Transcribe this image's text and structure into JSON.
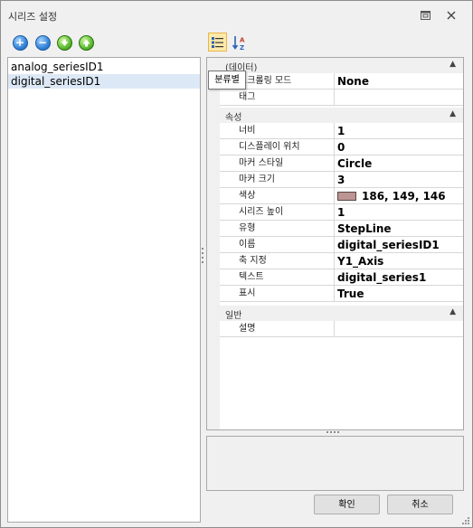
{
  "window": {
    "title": "시리즈 설정"
  },
  "left_toolbar": {
    "icons": [
      "add-icon",
      "remove-icon",
      "move-down-icon",
      "move-up-icon"
    ]
  },
  "right_toolbar": {
    "icons": [
      "categorized-icon",
      "sort-alphabetical-icon"
    ]
  },
  "series_list": {
    "items": [
      "analog_seriesID1",
      "digital_seriesID1"
    ],
    "selected_index": 1
  },
  "tooltip": "분류별",
  "property_grid": {
    "categories": [
      {
        "name": "(데이터)",
        "rows": [
          {
            "name": "스크롤링 모드",
            "value": "None"
          },
          {
            "name": "태그",
            "value": ""
          }
        ]
      },
      {
        "name": "속성",
        "rows": [
          {
            "name": "너비",
            "value": "1"
          },
          {
            "name": "디스플레이 위치",
            "value": "0"
          },
          {
            "name": "마커 스타일",
            "value": "Circle"
          },
          {
            "name": "마커 크기",
            "value": "3"
          },
          {
            "name": "색상",
            "value": "186, 149, 146",
            "color": "#ba9592"
          },
          {
            "name": "시리즈 높이",
            "value": "1"
          },
          {
            "name": "유형",
            "value": "StepLine"
          },
          {
            "name": "이름",
            "value": "digital_seriesID1"
          },
          {
            "name": "축 지정",
            "value": "Y1_Axis"
          },
          {
            "name": "텍스트",
            "value": "digital_series1"
          },
          {
            "name": "표시",
            "value": "True"
          }
        ]
      },
      {
        "name": "일반",
        "rows": [
          {
            "name": "설명",
            "value": ""
          }
        ]
      }
    ]
  },
  "buttons": {
    "ok": "확인",
    "cancel": "취소"
  }
}
